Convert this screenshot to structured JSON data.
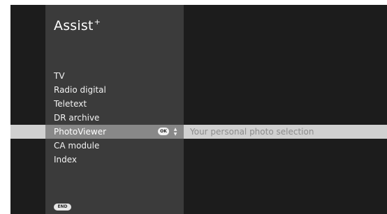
{
  "app": {
    "title": "Assist",
    "title_suffix": "+"
  },
  "menu": {
    "items": [
      {
        "label": "TV"
      },
      {
        "label": "Radio digital"
      },
      {
        "label": "Teletext"
      },
      {
        "label": "DR archive"
      },
      {
        "label": "PhotoViewer",
        "selected": true,
        "description": "Your personal photo selection"
      },
      {
        "label": "CA module"
      },
      {
        "label": "Index"
      }
    ]
  },
  "hints": {
    "ok_label": "OK",
    "updown_up": "▲",
    "updown_down": "▼",
    "end_label": "END"
  },
  "colors": {
    "screen_bg": "#1c1c1c",
    "menu_bg": "#3b3b3b",
    "selected_left_bg": "#888888",
    "selected_bar_bg": "#d0d0d0",
    "description_text": "#8c8c8c"
  },
  "icons": {
    "ok": "ok-button-icon",
    "updown": "up-down-arrows-icon",
    "end": "end-button-icon"
  }
}
